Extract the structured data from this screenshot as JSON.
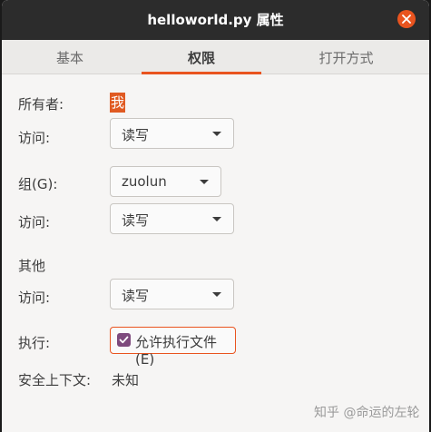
{
  "window": {
    "title": "helloworld.py 属性"
  },
  "tabs": [
    {
      "label": "基本",
      "active": false
    },
    {
      "label": "权限",
      "active": true
    },
    {
      "label": "打开方式",
      "active": false
    }
  ],
  "owner": {
    "label": "所有者:",
    "value": "我"
  },
  "owner_access": {
    "label": "访问:",
    "value": "读写"
  },
  "group": {
    "label": "组(G):",
    "value": "zuolun"
  },
  "group_access": {
    "label": "访问:",
    "value": "读写"
  },
  "others": {
    "heading": "其他"
  },
  "others_access": {
    "label": "访问:",
    "value": "读写"
  },
  "execute": {
    "label": "执行:",
    "checkbox_label": "允许执行文件(E)",
    "checked": true
  },
  "security_context": {
    "label": "安全上下文:",
    "value": "未知"
  },
  "watermark": "知乎 @命运的左轮",
  "colors": {
    "accent": "#e9541f",
    "checkbox": "#7e4a7d",
    "titlebar": "#2c2c2c"
  }
}
